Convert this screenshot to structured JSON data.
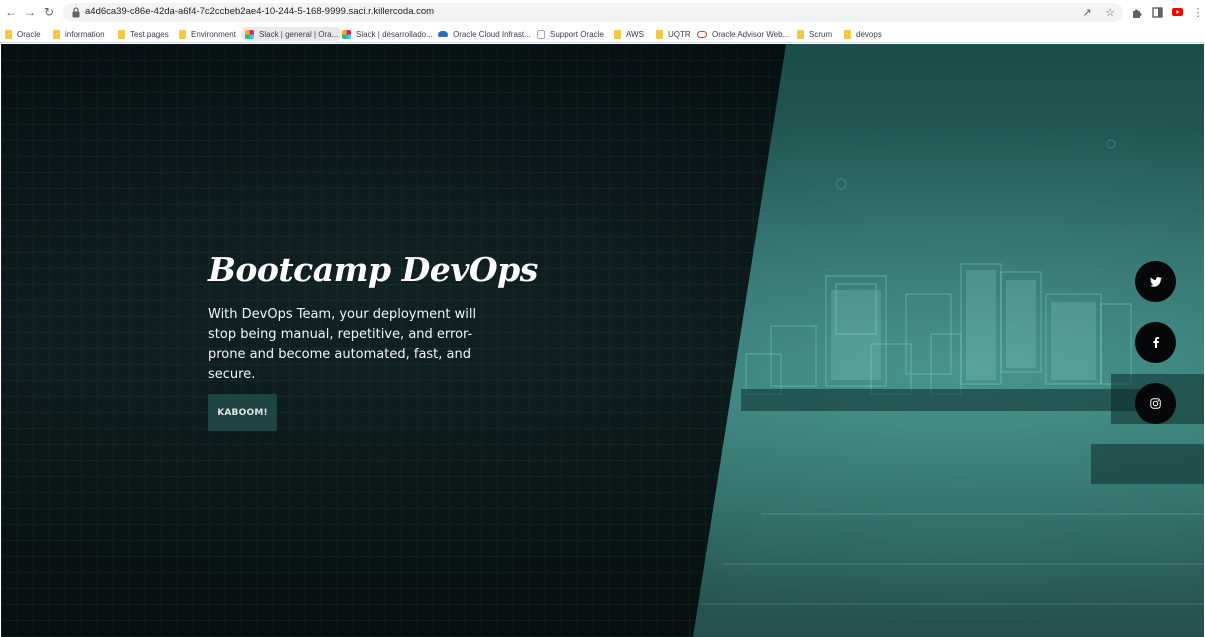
{
  "browser": {
    "url": "a4d6ca39-c86e-42da-a6f4-7c2ccbeb2ae4-10-244-5-168-9999.saci.r.killercoda.com",
    "bookmarks": [
      {
        "label": "Oracle",
        "icon": "folder-icon"
      },
      {
        "label": "information",
        "icon": "folder-icon"
      },
      {
        "label": "Test pages",
        "icon": "folder-icon"
      },
      {
        "label": "Environment",
        "icon": "folder-icon"
      },
      {
        "label": "Slack | general | Ora...",
        "icon": "slack-icon"
      },
      {
        "label": "Slack | desarrollado...",
        "icon": "slack-icon"
      },
      {
        "label": "Oracle Cloud Infrast...",
        "icon": "cloud-icon"
      },
      {
        "label": "Support Oracle",
        "icon": "support-icon"
      },
      {
        "label": "AWS",
        "icon": "folder-icon"
      },
      {
        "label": "UQTR",
        "icon": "folder-icon"
      },
      {
        "label": "Oracle Advisor Web...",
        "icon": "oracle-icon"
      },
      {
        "label": "Scrum",
        "icon": "folder-icon"
      },
      {
        "label": "devops",
        "icon": "folder-icon"
      }
    ]
  },
  "hero": {
    "title": "Bootcamp DevOps",
    "subtitle": "With DevOps Team, your deployment will stop being manual, repetitive, and error-prone and become automated, fast, and secure.",
    "button_label": "KABOOM!"
  },
  "social": [
    {
      "name": "twitter",
      "icon": "twitter-icon"
    },
    {
      "name": "facebook",
      "icon": "facebook-icon"
    },
    {
      "name": "instagram",
      "icon": "instagram-icon"
    }
  ],
  "colors": {
    "hero_dark": "#061013",
    "hero_teal": "#2c6561",
    "button_bg": "#1f4443",
    "social_bg": "#050708"
  }
}
